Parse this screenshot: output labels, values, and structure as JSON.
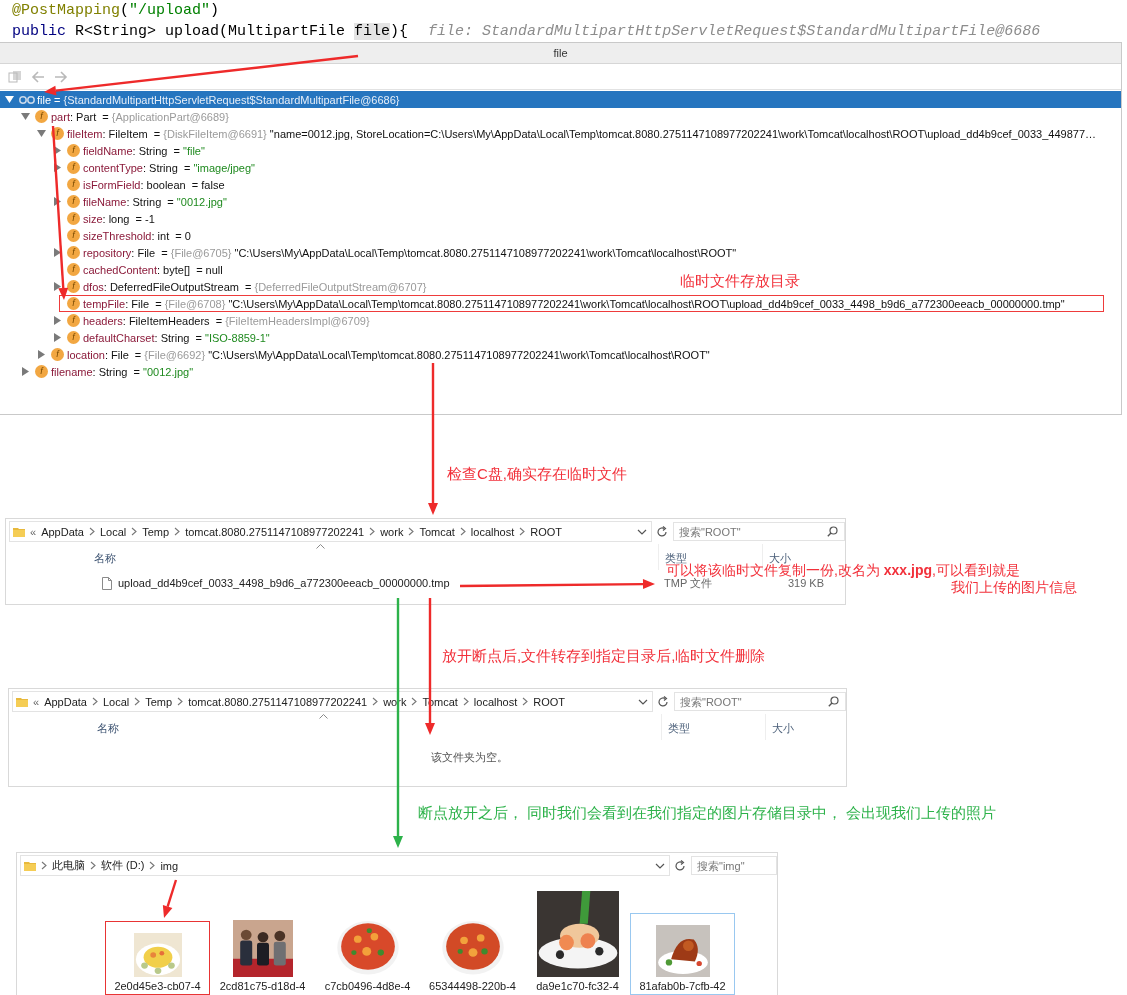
{
  "code": {
    "lines": [
      {
        "tokens": [
          {
            "text": "@PostMapping",
            "kind": "annotation"
          },
          {
            "text": "(",
            "kind": "plain"
          },
          {
            "text": "\"/upload\"",
            "kind": "string"
          },
          {
            "text": ")",
            "kind": "plain"
          }
        ]
      },
      {
        "tokens": [
          {
            "text": "public",
            "kind": "keyword"
          },
          {
            "text": " R<String> upload(MultipartFile ",
            "kind": "plain"
          },
          {
            "text": "file",
            "kind": "highlight"
          },
          {
            "text": "){",
            "kind": "plain"
          }
        ],
        "hint": "file: StandardMultipartHttpServletRequest$StandardMultipartFile@6686"
      }
    ]
  },
  "debugger": {
    "title": "file",
    "toolbar": [
      {
        "kind": "copy",
        "disabled": true
      },
      {
        "kind": "back",
        "disabled": true
      },
      {
        "kind": "forward",
        "disabled": true
      }
    ],
    "tree": [
      {
        "kind": "watch",
        "expanded": true,
        "selected": true,
        "boxed": false,
        "segments": [
          {
            "text": "file",
            "kind": "name"
          },
          {
            "text": " = ",
            "kind": "plain"
          },
          {
            "text": "{StandardMultipartHttpServletRequest$StandardMultipartFile@6686}",
            "kind": "ref"
          }
        ],
        "children": [
          {
            "kind": "field",
            "badge": "f",
            "expanded": true,
            "selected": false,
            "boxed": false,
            "segments": [
              {
                "text": "part",
                "kind": "name"
              },
              {
                "text": ": Part  = ",
                "kind": "plain"
              },
              {
                "text": "{ApplicationPart@6689}",
                "kind": "ref"
              }
            ],
            "children": [
              {
                "kind": "field",
                "badge": "f",
                "expanded": true,
                "selected": false,
                "boxed": false,
                "segments": [
                  {
                    "text": "fileItem",
                    "kind": "name"
                  },
                  {
                    "text": ": FileItem  = ",
                    "kind": "plain"
                  },
                  {
                    "text": "{DiskFileItem@6691}",
                    "kind": "ref"
                  },
                  {
                    "text": " \"name=0012.jpg, StoreLocation=C:\\Users\\My\\AppData\\Local\\Temp\\tomcat.8080.2751147108977202241\\work\\Tomcat\\localhost\\ROOT\\upload_dd4b9cef_0033_449877…",
                    "kind": "plain"
                  }
                ],
                "children": [
                  {
                    "kind": "field",
                    "badge": "f",
                    "expanded": false,
                    "selected": false,
                    "boxed": false,
                    "segments": [
                      {
                        "text": "fieldName",
                        "kind": "name"
                      },
                      {
                        "text": ": String  = ",
                        "kind": "plain"
                      },
                      {
                        "text": "\"file\"",
                        "kind": "string"
                      }
                    ]
                  },
                  {
                    "kind": "field",
                    "badge": "f",
                    "expanded": false,
                    "selected": false,
                    "boxed": false,
                    "segments": [
                      {
                        "text": "contentType",
                        "kind": "name"
                      },
                      {
                        "text": ": String  = ",
                        "kind": "plain"
                      },
                      {
                        "text": "\"image/jpeg\"",
                        "kind": "string"
                      }
                    ]
                  },
                  {
                    "kind": "field",
                    "badge": "f",
                    "selected": false,
                    "boxed": false,
                    "segments": [
                      {
                        "text": "isFormField",
                        "kind": "name"
                      },
                      {
                        "text": ": boolean  = false",
                        "kind": "plain"
                      }
                    ]
                  },
                  {
                    "kind": "field",
                    "badge": "f",
                    "expanded": false,
                    "selected": false,
                    "boxed": false,
                    "segments": [
                      {
                        "text": "fileName",
                        "kind": "name"
                      },
                      {
                        "text": ": String  = ",
                        "kind": "plain"
                      },
                      {
                        "text": "\"0012.jpg\"",
                        "kind": "string"
                      }
                    ]
                  },
                  {
                    "kind": "field",
                    "badge": "f",
                    "selected": false,
                    "boxed": false,
                    "segments": [
                      {
                        "text": "size",
                        "kind": "name"
                      },
                      {
                        "text": ": long  = -1",
                        "kind": "plain"
                      }
                    ]
                  },
                  {
                    "kind": "field",
                    "badge": "f",
                    "selected": false,
                    "boxed": false,
                    "segments": [
                      {
                        "text": "sizeThreshold",
                        "kind": "name"
                      },
                      {
                        "text": ": int  = 0",
                        "kind": "plain"
                      }
                    ]
                  },
                  {
                    "kind": "field",
                    "badge": "f",
                    "expanded": false,
                    "selected": false,
                    "boxed": false,
                    "segments": [
                      {
                        "text": "repository",
                        "kind": "name"
                      },
                      {
                        "text": ": File  = ",
                        "kind": "plain"
                      },
                      {
                        "text": "{File@6705}",
                        "kind": "ref"
                      },
                      {
                        "text": " \"C:\\Users\\My\\AppData\\Local\\Temp\\tomcat.8080.2751147108977202241\\work\\Tomcat\\localhost\\ROOT\"",
                        "kind": "plain"
                      }
                    ]
                  },
                  {
                    "kind": "field",
                    "badge": "f",
                    "selected": false,
                    "boxed": false,
                    "segments": [
                      {
                        "text": "cachedContent",
                        "kind": "name"
                      },
                      {
                        "text": ": byte[]  = null",
                        "kind": "plain"
                      }
                    ]
                  },
                  {
                    "kind": "field",
                    "badge": "f",
                    "expanded": false,
                    "selected": false,
                    "boxed": false,
                    "segments": [
                      {
                        "text": "dfos",
                        "kind": "name"
                      },
                      {
                        "text": ": DeferredFileOutputStream  = ",
                        "kind": "plain"
                      },
                      {
                        "text": "{DeferredFileOutputStream@6707}",
                        "kind": "ref"
                      }
                    ]
                  },
                  {
                    "kind": "field",
                    "badge": "f",
                    "selected": false,
                    "boxed": true,
                    "segments": [
                      {
                        "text": "tempFile",
                        "kind": "name"
                      },
                      {
                        "text": ": File  = ",
                        "kind": "plain"
                      },
                      {
                        "text": "{File@6708}",
                        "kind": "ref"
                      },
                      {
                        "text": " \"C:\\Users\\My\\AppData\\Local\\Temp\\tomcat.8080.2751147108977202241\\work\\Tomcat\\localhost\\ROOT\\upload_dd4b9cef_0033_4498_b9d6_a772300eeacb_00000000.tmp\"",
                        "kind": "plain"
                      }
                    ]
                  },
                  {
                    "kind": "field",
                    "badge": "f",
                    "expanded": false,
                    "selected": false,
                    "boxed": false,
                    "segments": [
                      {
                        "text": "headers",
                        "kind": "name"
                      },
                      {
                        "text": ": FileItemHeaders  = ",
                        "kind": "plain"
                      },
                      {
                        "text": "{FileItemHeadersImpl@6709}",
                        "kind": "ref"
                      }
                    ]
                  },
                  {
                    "kind": "field",
                    "badge": "f",
                    "expanded": false,
                    "selected": false,
                    "boxed": false,
                    "segments": [
                      {
                        "text": "defaultCharset",
                        "kind": "name"
                      },
                      {
                        "text": ": String  = ",
                        "kind": "plain"
                      },
                      {
                        "text": "\"ISO-8859-1\"",
                        "kind": "string"
                      }
                    ]
                  }
                ]
              },
              {
                "kind": "field",
                "badge": "f",
                "expanded": false,
                "selected": false,
                "boxed": false,
                "segments": [
                  {
                    "text": "location",
                    "kind": "name"
                  },
                  {
                    "text": ": File  = ",
                    "kind": "plain"
                  },
                  {
                    "text": "{File@6692}",
                    "kind": "ref"
                  },
                  {
                    "text": " \"C:\\Users\\My\\AppData\\Local\\Temp\\tomcat.8080.2751147108977202241\\work\\Tomcat\\localhost\\ROOT\"",
                    "kind": "plain"
                  }
                ]
              }
            ]
          },
          {
            "kind": "field",
            "badge": "f",
            "expanded": false,
            "selected": false,
            "boxed": false,
            "segments": [
              {
                "text": "filename",
                "kind": "name"
              },
              {
                "text": ": String  = ",
                "kind": "plain"
              },
              {
                "text": "\"0012.jpg\"",
                "kind": "string"
              }
            ]
          }
        ]
      }
    ]
  },
  "notes": [
    {
      "text": "临时文件存放目录",
      "color": "#f2303a"
    },
    {
      "text": "检查C盘,确实存在临时文件",
      "color": "#f2303a"
    },
    {
      "lines": [
        "可以将该临时文件复制一份,改名为 **xxx.jpg**,可以看到就是",
        "我们上传的图片信息"
      ],
      "color": "#f2303a"
    },
    {
      "text": "放开断点后,文件转存到指定目录后,临时文件删除",
      "color": "#f2303a"
    },
    {
      "text": "断点放开之后， 同时我们会看到在我们指定的图片存储目录中， 会出现我们上传的照片",
      "color": "#2db24a"
    }
  ],
  "explorer_temp": {
    "prefix": "«",
    "crumbs": [
      "AppData",
      "Local",
      "Temp",
      "tomcat.8080.2751147108977202241",
      "work",
      "Tomcat",
      "localhost",
      "ROOT"
    ],
    "search_placeholder": "搜索\"ROOT\"",
    "search_icon": true,
    "columns": [
      {
        "label": "名称",
        "sorted": true
      },
      {
        "label": "类型",
        "sorted": false
      },
      {
        "label": "大小",
        "sorted": false
      }
    ],
    "rows": [
      {
        "name": "upload_dd4b9cef_0033_4498_b9d6_a772300eeacb_00000000.tmp",
        "type": "TMP 文件",
        "size": "319 KB"
      }
    ]
  },
  "explorer_empty": {
    "prefix": "«",
    "crumbs": [
      "AppData",
      "Local",
      "Temp",
      "tomcat.8080.2751147108977202241",
      "work",
      "Tomcat",
      "localhost",
      "ROOT"
    ],
    "search_placeholder": "搜索\"ROOT\"",
    "search_icon": true,
    "columns": [
      {
        "label": "名称",
        "sorted": true
      },
      {
        "label": "类型",
        "sorted": false
      },
      {
        "label": "大小",
        "sorted": false
      }
    ],
    "empty_text": "该文件夹为空。"
  },
  "explorer_img": {
    "crumbs": [
      "此电脑",
      "软件 (D:)",
      "img"
    ],
    "search_placeholder": "搜索\"img\"",
    "search_icon": false,
    "items": [
      {
        "name": "2e0d45e3-cb07-4",
        "kind": "picture",
        "boxed": true,
        "selected": false
      },
      {
        "name": "2cd81c75-d18d-4",
        "kind": "picture",
        "boxed": false,
        "selected": false
      },
      {
        "name": "c7cb0496-4d8e-4",
        "kind": "picture",
        "boxed": false,
        "selected": false
      },
      {
        "name": "65344498-220b-4",
        "kind": "picture",
        "boxed": false,
        "selected": false
      },
      {
        "name": "da9e1c70-fc32-4",
        "kind": "picture",
        "boxed": false,
        "selected": false
      },
      {
        "name": "81afab0b-7cfb-42",
        "kind": "picture",
        "boxed": false,
        "selected": true
      }
    ]
  }
}
